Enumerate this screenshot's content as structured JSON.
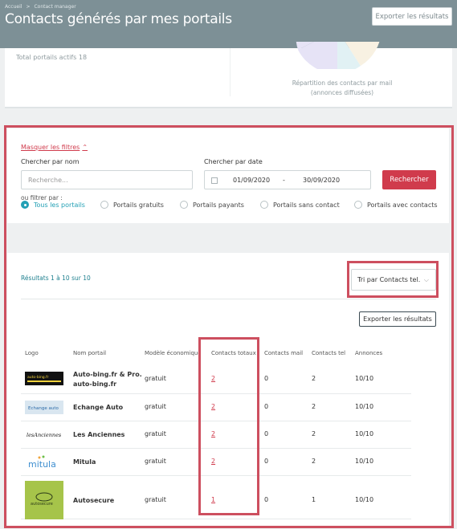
{
  "header": {
    "breadcrumb": [
      "Accueil",
      "Contact manager"
    ],
    "title": "Contacts générés par mes portails",
    "export_label": "Exporter les résultats"
  },
  "stats": {
    "total_portails": "Total portails actifs 18",
    "pie_caption_line1": "Répartition des contacts par mail",
    "pie_caption_line2": "(annonces diffusées)",
    "pie_colors": [
      "#e6e3f6",
      "#e1f1f4",
      "#f8f1e2"
    ]
  },
  "filters": {
    "toggle_label": "Masquer les filtres",
    "toggle_icon": "chevron-up-icon",
    "name_label": "Chercher par nom",
    "name_placeholder": "Recherche...",
    "date_label": "Chercher par date",
    "date_from": "01/09/2020",
    "date_sep": "-",
    "date_to": "30/09/2020",
    "search_button": "Rechercher",
    "filter_by": "ou filtrer par :",
    "options": [
      {
        "label": "Tous les portails",
        "selected": true
      },
      {
        "label": "Portails gratuits",
        "selected": false
      },
      {
        "label": "Portails payants",
        "selected": false
      },
      {
        "label": "Portails sans contact",
        "selected": false
      },
      {
        "label": "Portails avec contacts",
        "selected": false
      }
    ]
  },
  "results": {
    "count_text": "Résultats 1 à 10 sur 10",
    "sort_label": "Tri par Contacts tel.",
    "export_label": "Exporter les résultats",
    "columns": [
      "Logo",
      "Nom portail",
      "Modèle économique",
      "Contacts totaux",
      "Contacts mail",
      "Contacts tel",
      "Annonces"
    ],
    "rows": [
      {
        "name_line1": "Auto-bing.fr & Pro.",
        "name_line2": "auto-bing.fr",
        "model": "gratuit",
        "total": "2",
        "mail": "0",
        "tel": "2",
        "annonces": "10/10",
        "logo_text": "auto-bing.fr"
      },
      {
        "name_line1": "Echange Auto",
        "name_line2": "",
        "model": "gratuit",
        "total": "2",
        "mail": "0",
        "tel": "2",
        "annonces": "10/10",
        "logo_text": "Echange auto"
      },
      {
        "name_line1": "Les Anciennes",
        "name_line2": "",
        "model": "gratuit",
        "total": "2",
        "mail": "0",
        "tel": "2",
        "annonces": "10/10",
        "logo_text": "lesAnciennes"
      },
      {
        "name_line1": "Mitula",
        "name_line2": "",
        "model": "gratuit",
        "total": "2",
        "mail": "0",
        "tel": "2",
        "annonces": "10/10",
        "logo_text": "mitula"
      },
      {
        "name_line1": "Autosecure",
        "name_line2": "",
        "model": "gratuit",
        "total": "1",
        "mail": "0",
        "tel": "1",
        "annonces": "10/10",
        "logo_text": "autosecure"
      }
    ]
  }
}
